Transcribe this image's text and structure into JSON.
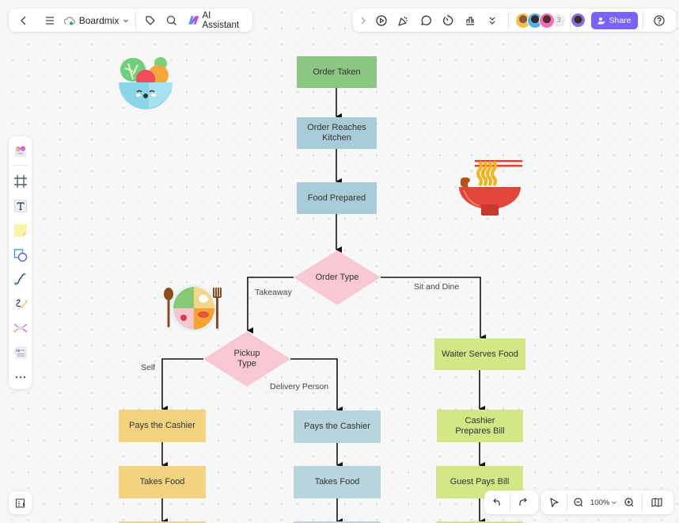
{
  "topbar": {
    "back_label": "Back",
    "menu_label": "Menu",
    "brand": "Boardmix",
    "ai_assistant": "AI Assistant",
    "collaborator_count": "3",
    "share_label": "Share"
  },
  "left_toolbar": {
    "tools": [
      "Templates",
      "Frame",
      "Text",
      "Sticky Note",
      "Shapes",
      "Connector",
      "Pen",
      "Mind Map",
      "Cards",
      "More"
    ]
  },
  "zoom": {
    "level": "100%"
  },
  "flowchart": {
    "nodes": {
      "order_taken": "Order Taken",
      "order_reaches_kitchen": "Order Reaches Kitchen",
      "food_prepared": "Food Prepared",
      "order_type": "Order Type",
      "pickup_type": "Pickup Type",
      "waiter_serves_food": "Waiter Serves Food",
      "self_pays_cashier": "Pays the Cashier",
      "self_takes_food": "Takes Food",
      "delivery_pays_cashier": "Pays the Cashier",
      "delivery_takes_food": "Takes Food",
      "cashier_prepares_bill": "Cashier Prepares Bill",
      "guest_pays_bill": "Guest Pays Bill"
    },
    "edge_labels": {
      "takeaway": "Takeaway",
      "sit_and_dine": "Sit and Dine",
      "self": "Self",
      "delivery_person": "Delivery Person"
    }
  },
  "colors": {
    "accent": "#7b61f7",
    "node_green": "#8bc683",
    "node_blue": "#a8ccd7",
    "node_pink": "#f8c8d4",
    "node_yellow": "#f3d37f",
    "node_lime": "#d4e786"
  }
}
